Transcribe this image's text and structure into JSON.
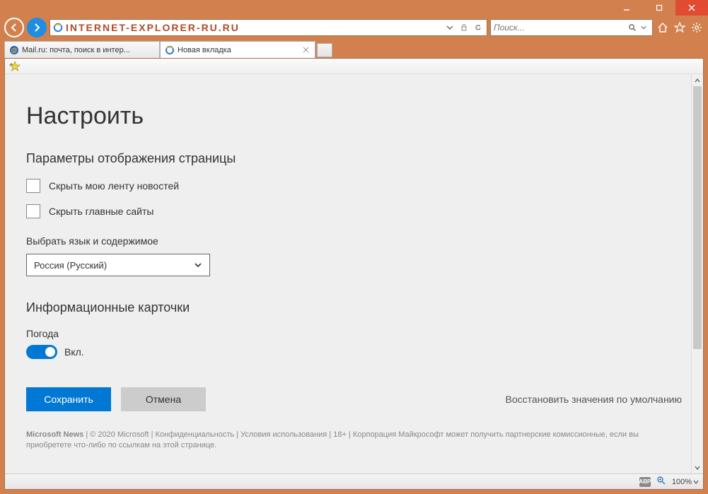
{
  "window": {
    "minimize": "minimize",
    "maximize": "maximize",
    "close": "close"
  },
  "toolbar": {
    "address_url": "INTERNET-EXPLORER-RU.RU",
    "search_placeholder": "Поиск..."
  },
  "tabs": [
    {
      "label": "Mail.ru: почта, поиск в интер...",
      "favicon": "mailru"
    },
    {
      "label": "Новая вкладка",
      "favicon": "ie"
    }
  ],
  "page": {
    "heading": "Настроить",
    "display_section": "Параметры отображения страницы",
    "hide_feed": "Скрыть мою ленту новостей",
    "hide_topsites": "Скрыть главные сайты",
    "language_label": "Выбрать язык и содержимое",
    "language_value": "Россия (Русский)",
    "cards_section": "Информационные карточки",
    "weather_label": "Погода",
    "toggle_state": "Вкл.",
    "save": "Сохранить",
    "cancel": "Отмена",
    "restore_defaults": "Восстановить значения по умолчанию",
    "footer_brand": "Microsoft News",
    "footer_copyright": " | © 2020 Microsoft | ",
    "footer_privacy": "Конфиденциальность",
    "footer_terms": "Условия использования",
    "footer_age": "18+",
    "footer_disclaimer": " | Корпорация Майкрософт может получить партнерские комиссионные, если вы приобретете что-либо по ссылкам на этой странице."
  },
  "status": {
    "abp": "ABP",
    "zoom": "100%"
  }
}
